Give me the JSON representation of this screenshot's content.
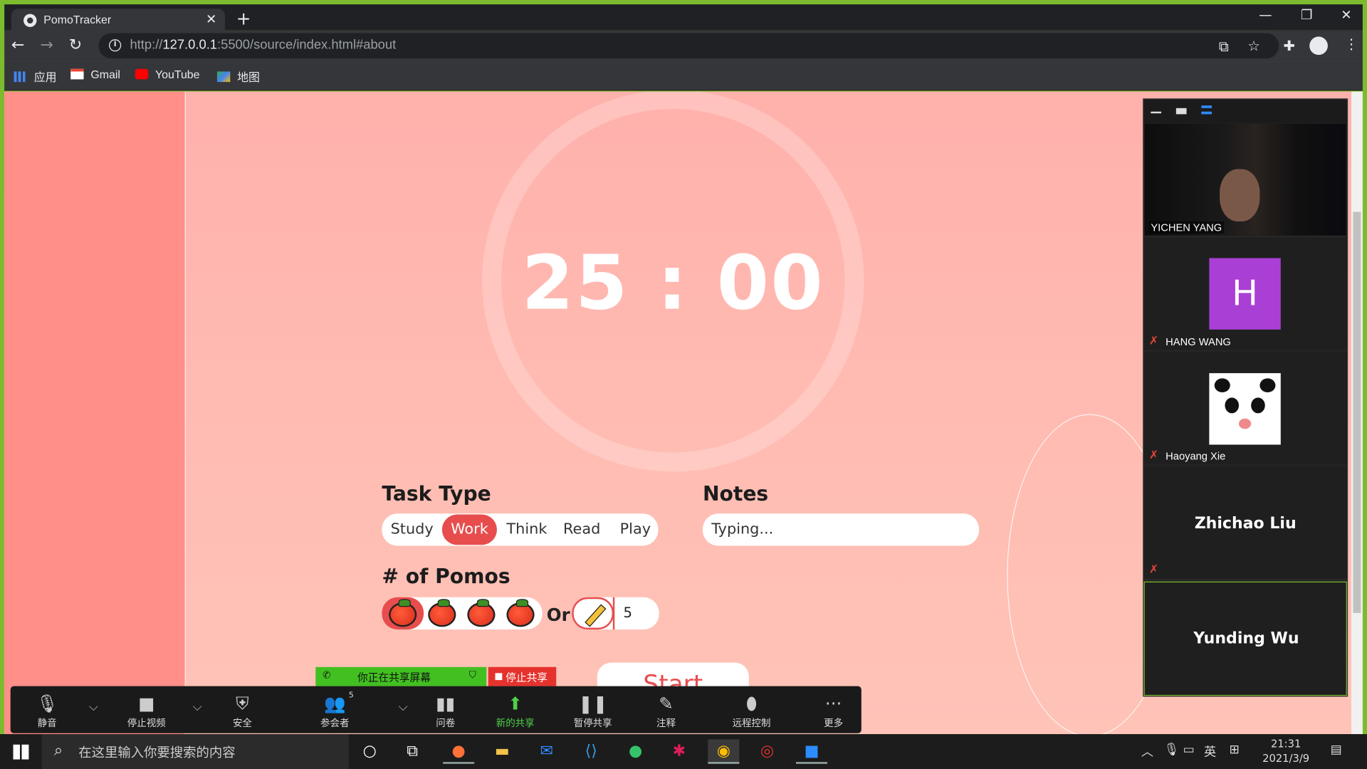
{
  "browser": {
    "tab_title": "PomoTracker",
    "url_prefix": "http://",
    "url_host": "127.0.0.1",
    "url_rest": ":5500/source/index.html#about",
    "bookmarks": [
      {
        "label": "应用",
        "icon": "apps-grid-icon"
      },
      {
        "label": "Gmail",
        "icon": "gmail-icon"
      },
      {
        "label": "YouTube",
        "icon": "youtube-icon"
      },
      {
        "label": "地图",
        "icon": "maps-icon"
      }
    ]
  },
  "app": {
    "timer": "25 : 00",
    "task_type_heading": "Task Type",
    "task_types": [
      "Study",
      "Work",
      "Think",
      "Read",
      "Play"
    ],
    "task_type_selected": "Work",
    "notes_heading": "Notes",
    "notes_placeholder": "Typing...",
    "pomos_heading": "# of Pomos",
    "pomo_count_options": 4,
    "pomo_selected_index": 0,
    "or_label": "Or",
    "custom_pomos_value": "5",
    "start_label": "Start",
    "colors": {
      "accent": "#e84d4d",
      "background": "#ffb8b0",
      "sidebar": "#ff8f88"
    }
  },
  "zoom": {
    "sharing_notice": "你正在共享屏幕",
    "stop_share": "停止共享",
    "participants_count": "5",
    "toolbar": [
      {
        "label": "静音",
        "icon": "microphone-icon"
      },
      {
        "label": "停止视频",
        "icon": "video-camera-icon"
      },
      {
        "label": "安全",
        "icon": "shield-icon"
      },
      {
        "label": "参会者",
        "icon": "participants-icon"
      },
      {
        "label": "问卷",
        "icon": "poll-icon"
      },
      {
        "label": "新的共享",
        "icon": "share-screen-icon"
      },
      {
        "label": "暂停共享",
        "icon": "pause-icon"
      },
      {
        "label": "注释",
        "icon": "pencil-icon"
      },
      {
        "label": "远程控制",
        "icon": "mouse-icon"
      },
      {
        "label": "更多",
        "icon": "more-dots-icon"
      }
    ],
    "participants": [
      {
        "name": "YICHEN YANG",
        "kind": "video"
      },
      {
        "name": "HANG WANG",
        "kind": "initial",
        "initial": "H",
        "muted": true
      },
      {
        "name": "Haoyang Xie",
        "kind": "picture",
        "muted": true
      },
      {
        "name": "Zhichao Liu",
        "kind": "name",
        "muted": true
      },
      {
        "name": "Yunding Wu",
        "kind": "name-active"
      }
    ]
  },
  "taskbar": {
    "search_placeholder": "在这里输入你要搜索的内容",
    "ime": "英",
    "time": "21:31",
    "date": "2021/3/9"
  }
}
